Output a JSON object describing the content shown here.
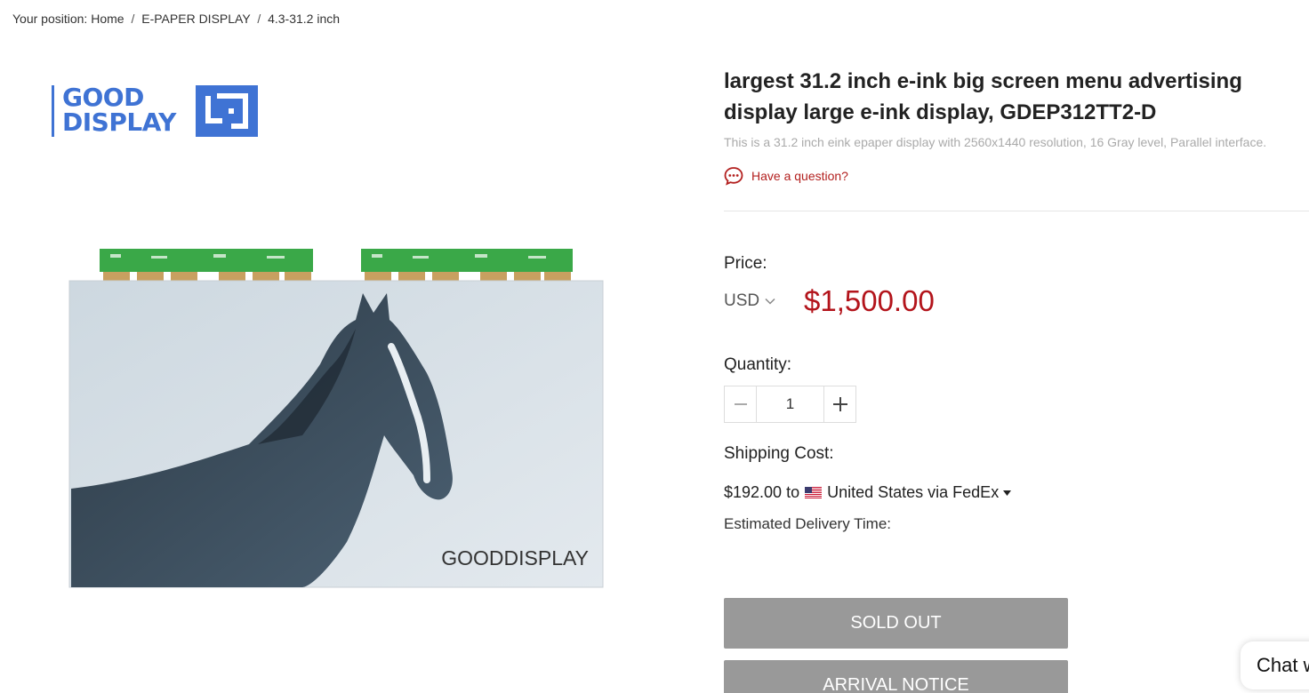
{
  "breadcrumb": {
    "prefix": "Your position:",
    "items": [
      "Home",
      "E-PAPER DISPLAY",
      "4.3-31.2 inch"
    ],
    "separator": "/"
  },
  "gallery": {
    "logo": {
      "line1": "GOOD",
      "line2": "DISPLAY",
      "color": "#3f73d4"
    },
    "image_caption": "GOODDISPLAY"
  },
  "product": {
    "title": "largest 31.2 inch e-ink big screen menu advertising display large e-ink display, GDEP312TT2-D",
    "subtitle": "This is a 31.2 inch eink epaper display with 2560x1440 resolution, 16 Gray level, Parallel interface.",
    "question_link": "Have a question?",
    "price_label": "Price:",
    "currency": "USD",
    "price": "$1,500.00",
    "quantity_label": "Quantity:",
    "quantity": "1",
    "shipping_label": "Shipping Cost:",
    "shipping_cost": "$192.00",
    "shipping_to": "to",
    "shipping_dest": "United States via FedEx",
    "eta_label": "Estimated Delivery Time:",
    "sold_out": "SOLD OUT",
    "arrival_notice": "ARRIVAL NOTICE"
  },
  "chat": {
    "label": "Chat w"
  },
  "colors": {
    "accent": "#b3141b",
    "button": "#999999",
    "brand": "#3f73d4"
  }
}
